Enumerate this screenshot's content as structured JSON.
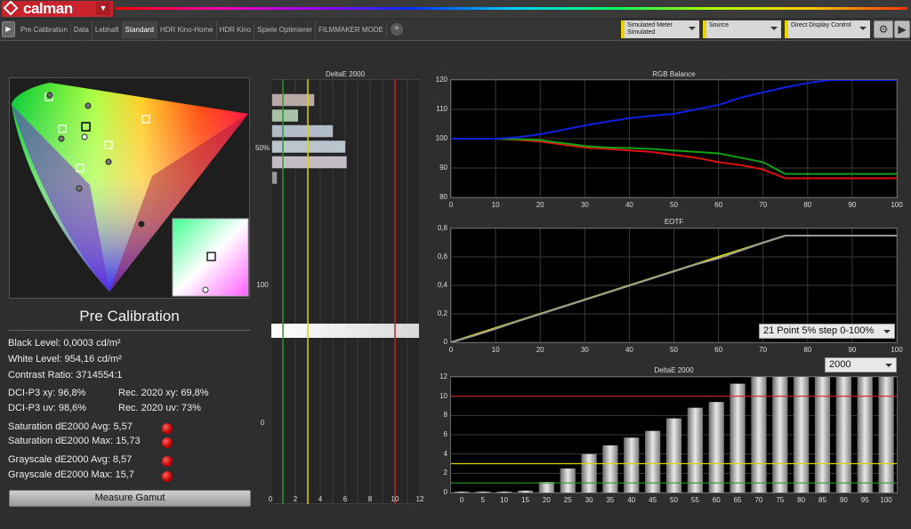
{
  "app": {
    "name": "calman"
  },
  "tabs": [
    "Pre Calibration",
    "Data",
    "Lebhaft",
    "Standard",
    "HDR Kino-Home",
    "HDR Kino",
    "Spiele Optimierer",
    "FILMMAKER MODE"
  ],
  "active_tab": "Standard",
  "dropdowns": {
    "meter": {
      "label": "Simulated Meter",
      "value": "Simulated"
    },
    "source": {
      "label": "Source"
    },
    "display": {
      "label": "Direct Display Control"
    }
  },
  "section_title": "Pre Calibration",
  "stats": {
    "black_level": "Black Level: 0,0003 cd/m²",
    "white_level": "White Level: 954,16 cd/m²",
    "contrast": "Contrast Ratio: 3714554:1",
    "p3_xy": "DCI-P3 xy: 96,8%",
    "rec2020_xy": "Rec. 2020 xy: 69,8%",
    "p3_uv": "DCI-P3 uv: 98,6%",
    "rec2020_uv": "Rec. 2020 uv: 73%",
    "sat_avg": "Saturation dE2000 Avg: 5,57",
    "sat_max": "Saturation dE2000 Max: 15,73",
    "gray_avg": "Grayscale dE2000 Avg: 8,57",
    "gray_max": "Grayscale dE2000 Max: 15,7"
  },
  "measure_button": "Measure Gamut",
  "status_colors": {
    "fail": "#cc0000"
  },
  "chart_data": [
    {
      "type": "bar",
      "title": "DeltaE 2000",
      "orientation": "horizontal",
      "xlim": [
        0,
        12
      ],
      "x_ticks": [
        "0",
        "2",
        "4",
        "6",
        "8",
        "10",
        "12"
      ],
      "y_tick_labels": [
        "50%",
        "100",
        "0"
      ],
      "values": [
        3.5,
        2.2,
        5.0,
        6.0,
        6.1,
        0.5
      ],
      "threshold_lines": [
        {
          "value": 1,
          "color": "#2a9a2a"
        },
        {
          "value": 3,
          "color": "#e0d000"
        },
        {
          "value": 10,
          "color": "#d02020"
        }
      ]
    },
    {
      "type": "line",
      "title": "RGB Balance",
      "x": [
        0,
        5,
        10,
        15,
        20,
        25,
        30,
        35,
        40,
        45,
        50,
        55,
        60,
        65,
        70,
        75,
        80,
        85,
        90,
        95,
        100
      ],
      "xlim": [
        0,
        100
      ],
      "ylim": [
        80,
        120
      ],
      "y_ticks": [
        "80",
        "90",
        "100",
        "110",
        "120"
      ],
      "x_ticks": [
        "0",
        "10",
        "20",
        "30",
        "40",
        "50",
        "60",
        "70",
        "80",
        "90",
        "100"
      ],
      "series": [
        {
          "color": "#e01010",
          "values": [
            100,
            100,
            100,
            99.6,
            99,
            98,
            97,
            96.5,
            96,
            95.5,
            94.5,
            93.5,
            92,
            91,
            89.5,
            86.5,
            86.5,
            86.5,
            86.5,
            86.5,
            86.5
          ]
        },
        {
          "color": "#10a010",
          "values": [
            100,
            100,
            100,
            99.8,
            99.5,
            98.5,
            97.5,
            97,
            96.8,
            96.5,
            96,
            95.5,
            95,
            93.5,
            92,
            88,
            88,
            88,
            88,
            88,
            88
          ]
        },
        {
          "color": "#1020e0",
          "values": [
            100,
            100,
            100,
            100.5,
            101.5,
            103,
            104.5,
            105.8,
            107,
            107.8,
            108.5,
            110,
            111.5,
            114,
            115.8,
            117.5,
            119,
            120,
            120,
            120,
            120
          ]
        }
      ]
    },
    {
      "type": "line",
      "title": "EOTF",
      "x": [
        0,
        5,
        10,
        15,
        20,
        25,
        30,
        35,
        40,
        45,
        50,
        55,
        60,
        65,
        70,
        75,
        80,
        85,
        90,
        95,
        100
      ],
      "xlim": [
        0,
        100
      ],
      "ylim": [
        0,
        0.8
      ],
      "y_ticks": [
        "0",
        "0,2",
        "0,4",
        "0,6",
        "0,8"
      ],
      "x_ticks": [
        "0",
        "10",
        "20",
        "30",
        "40",
        "50",
        "60",
        "70",
        "80",
        "90",
        "100"
      ],
      "series": [
        {
          "color": "#e8e800",
          "values": [
            0,
            0.05,
            0.1,
            0.15,
            0.2,
            0.25,
            0.3,
            0.35,
            0.4,
            0.45,
            0.5,
            0.55,
            0.6,
            0.65,
            0.7,
            0.75,
            0.75,
            0.75,
            0.75,
            0.75,
            0.75
          ]
        },
        {
          "color": "#999999",
          "values": [
            0,
            0.045,
            0.095,
            0.148,
            0.198,
            0.248,
            0.298,
            0.348,
            0.398,
            0.448,
            0.498,
            0.548,
            0.59,
            0.645,
            0.7,
            0.75,
            0.75,
            0.75,
            0.75,
            0.75,
            0.75
          ]
        }
      ],
      "dropdown": "21 Point 5% step 0-100%"
    },
    {
      "type": "bar",
      "title": "DeltaE 2000",
      "categories": [
        "0",
        "5",
        "10",
        "15",
        "20",
        "25",
        "30",
        "35",
        "40",
        "45",
        "50",
        "55",
        "60",
        "65",
        "70",
        "75",
        "80",
        "85",
        "90",
        "95",
        "100"
      ],
      "values": [
        0.1,
        0.1,
        0.1,
        0.2,
        1.1,
        2.5,
        4.0,
        4.9,
        5.7,
        6.4,
        7.7,
        8.8,
        9.4,
        11.3,
        15.7,
        15.7,
        15.7,
        15.7,
        15.7,
        15.7,
        15.7
      ],
      "ylim": [
        0,
        12
      ],
      "y_ticks": [
        "0",
        "2",
        "4",
        "6",
        "8",
        "10",
        "12"
      ],
      "threshold_lines": [
        {
          "value": 1,
          "color": "#2a9a2a"
        },
        {
          "value": 3,
          "color": "#e0d000"
        },
        {
          "value": 10,
          "color": "#d02020"
        }
      ],
      "selector": "2000"
    }
  ]
}
